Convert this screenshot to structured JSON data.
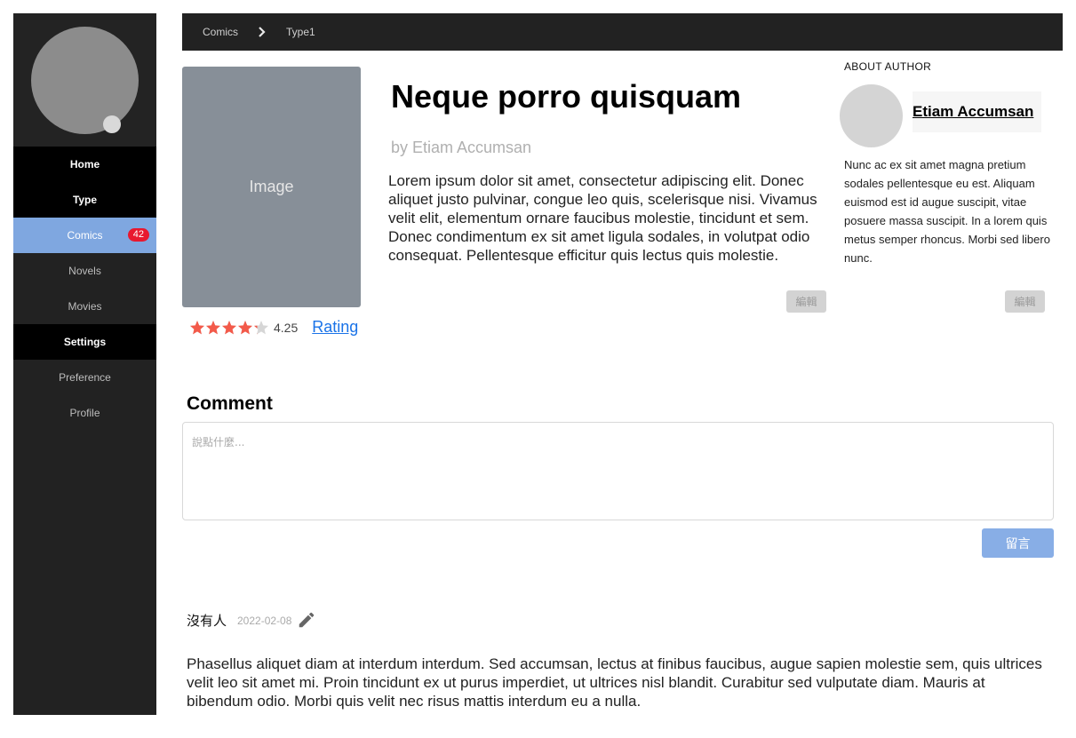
{
  "sidebar": {
    "items": [
      {
        "label": "Home"
      },
      {
        "label": "Type"
      },
      {
        "label": "Comics",
        "badge": "42"
      },
      {
        "label": "Novels"
      },
      {
        "label": "Movies"
      },
      {
        "label": "Settings"
      },
      {
        "label": "Preference"
      },
      {
        "label": "Profile"
      }
    ]
  },
  "breadcrumb": {
    "items": [
      "Comics",
      "Type1"
    ],
    "separator_icon": "chevron-right-icon"
  },
  "book": {
    "cover_placeholder": "Image",
    "title": "Neque porro quisquam",
    "by": "by Etiam Accumsan",
    "description": "Lorem ipsum dolor sit amet, consectetur adipiscing elit. Donec aliquet justo pulvinar, congue leo quis, scelerisque nisi. Vivamus velit elit, elementum ornare faucibus molestie, tincidunt et sem. Donec condimentum ex sit amet ligula sodales, in volutpat odio consequat. Pellentesque efficitur quis lectus quis molestie.",
    "edit_label": "編輯",
    "rating": 4.25,
    "rating_text": "4.25",
    "rating_max": 5,
    "rating_link": "Rating",
    "star_color": "#f35a4a"
  },
  "author": {
    "section_label": "ABOUT AUTHOR",
    "name": "Etiam Accumsan",
    "bio": "Nunc ac ex sit amet magna pretium sodales pellentesque eu est. Aliquam euismod est id augue suscipit, vitae posuere massa suscipit. In a lorem quis metus semper rhoncus. Morbi sed libero nunc.",
    "edit_label": "編輯"
  },
  "comment": {
    "heading": "Comment",
    "placeholder": "說點什麼...",
    "submit_label": "留言"
  },
  "comments": [
    {
      "author": "沒有人",
      "date": "2022-02-08",
      "edit_icon": "pencil-icon",
      "text": "Phasellus aliquet diam at interdum interdum. Sed accumsan, lectus at finibus faucibus, augue sapien molestie sem, quis ultrices velit leo sit amet mi. Proin tincidunt ex ut purus imperdiet, ut ultrices nisl blandit. Curabitur sed vulputate diam. Mauris at bibendum odio. Morbi quis velit nec risus mattis interdum eu a nulla."
    }
  ],
  "colors": {
    "sidebar_bg": "#222222",
    "active_nav": "#7fa7e0",
    "badge": "#e8182f",
    "link": "#1a73e8",
    "submit": "#88aee6"
  }
}
